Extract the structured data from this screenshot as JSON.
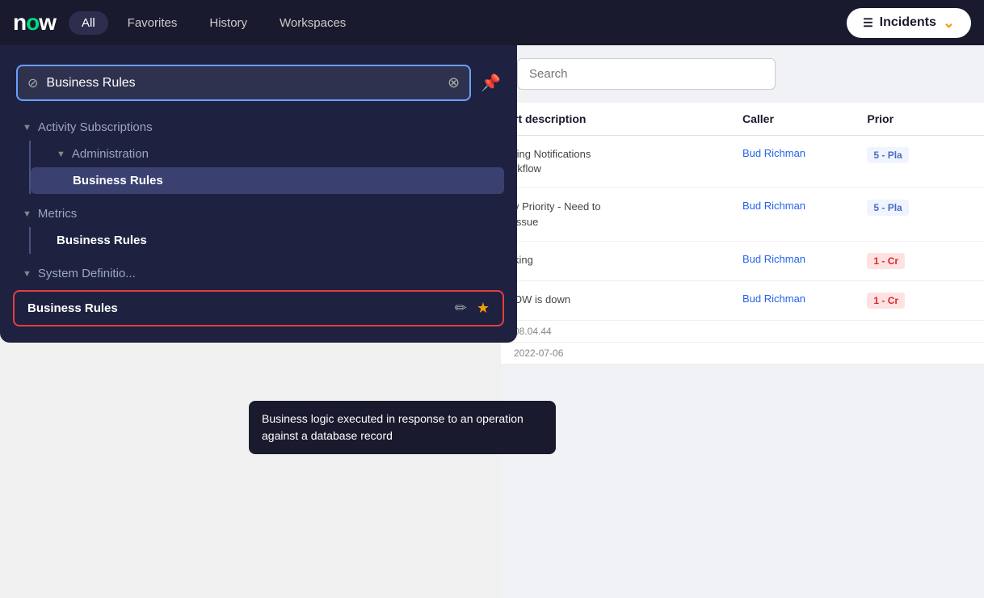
{
  "navbar": {
    "logo_text": "now",
    "tabs": [
      {
        "label": "All",
        "active": true
      },
      {
        "label": "Favorites",
        "active": false
      },
      {
        "label": "History",
        "active": false
      },
      {
        "label": "Workspaces",
        "active": false
      }
    ],
    "incidents_button": "Incidents"
  },
  "dropdown": {
    "search_value": "Business Rules",
    "search_placeholder": "Business Rules",
    "pin_label": "pin",
    "sections": [
      {
        "label": "Activity Subscriptions",
        "level": 0,
        "expanded": true
      },
      {
        "label": "Administration",
        "level": 1,
        "expanded": true
      },
      {
        "label": "Business Rules",
        "level": 2,
        "highlighted": true
      },
      {
        "label": "Metrics",
        "level": 0,
        "expanded": true
      },
      {
        "label": "Business Rules",
        "level": 1,
        "bold": true
      },
      {
        "label": "System Definition",
        "level": 0,
        "expanded": true,
        "partial": true
      }
    ],
    "last_item": {
      "label": "Business Rules",
      "edit_icon": "✏",
      "star_icon": "★"
    },
    "tooltip": "Business logic executed in response to an operation against a database record"
  },
  "incidents": {
    "search_placeholder": "Search",
    "table": {
      "columns": [
        "rt description",
        "Caller",
        "Prior"
      ],
      "rows": [
        {
          "description": "ting Notifications\nrkflow",
          "caller": "Bud Richman",
          "priority": "5 - Pla",
          "priority_type": "low"
        },
        {
          "description": "v Priority - Need to\nissue",
          "caller": "Bud Richman",
          "priority": "5 - Pla",
          "priority_type": "low"
        },
        {
          "description": "king",
          "caller": "Bud Richman",
          "priority": "1 - Cr",
          "priority_type": "critical"
        },
        {
          "description": "OW is down",
          "caller": "Bud Richman",
          "priority": "1 - Cr",
          "priority_type": "critical"
        }
      ],
      "date1": "08.04.44",
      "date2": "2022-07-06"
    }
  }
}
